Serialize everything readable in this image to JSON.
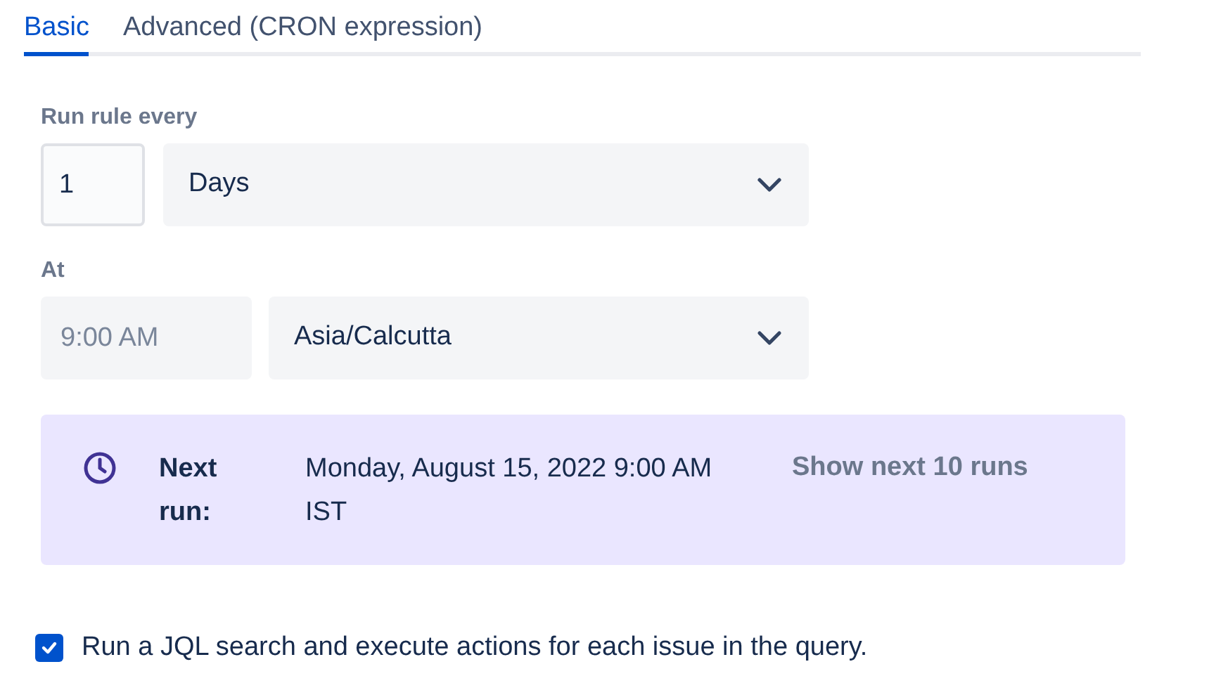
{
  "tabs": [
    {
      "label": "Basic",
      "selected": true
    },
    {
      "label": "Advanced (CRON expression)",
      "selected": false
    }
  ],
  "frequency": {
    "label": "Run rule every",
    "value": "1",
    "unit": "Days"
  },
  "time": {
    "label": "At",
    "placeholder": "9:00 AM",
    "timezone": "Asia/Calcutta"
  },
  "next_run": {
    "label": "Next run:",
    "value": "Monday, August 15, 2022 9:00 AM IST",
    "link": "Show next 10 runs"
  },
  "jql": {
    "label": "Run a JQL search and execute actions for each issue in the query.",
    "checked": true
  }
}
